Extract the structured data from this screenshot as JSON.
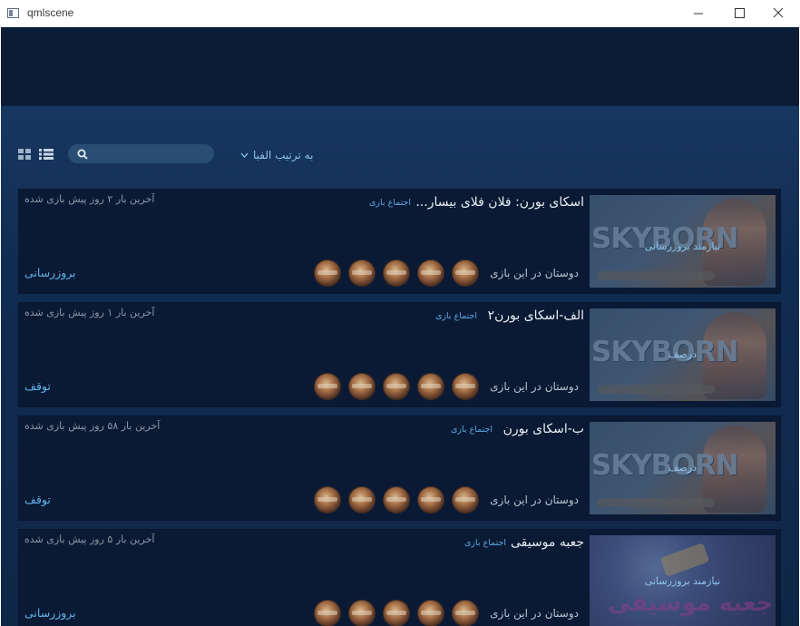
{
  "window": {
    "title": "qmlscene"
  },
  "toolbar": {
    "search_placeholder": "",
    "sort_label": "به ترتیب الفبا"
  },
  "games": [
    {
      "title": "اسکای بورن: فلان فلای بیسار...",
      "group_label": "اجتماع بازی",
      "last_played": "آخرین بار ۲ روز پیش بازی شده",
      "thumb_status": "نیازمند بروزرسانی",
      "friends_label": "دوستان در این بازی",
      "action": "بروزرسانی",
      "art": "skyborn"
    },
    {
      "title": "الف-اسکای بورن۲",
      "group_label": "اجتماع بازی",
      "last_played": "آخرین بار ۱ روز پیش بازی شده",
      "thumb_status": "درصف",
      "friends_label": "دوستان در این بازی",
      "action": "توقف",
      "art": "skyborn"
    },
    {
      "title": "ب-اسکای بورن",
      "group_label": "اجتماع بازی",
      "last_played": "آخرین بار ۵۸ روز پیش بازی شده",
      "thumb_status": "درصف",
      "friends_label": "دوستان در این بازی",
      "action": "توقف",
      "art": "skyborn"
    },
    {
      "title": "جعبه موسیقی",
      "group_label": "اجتماع بازی",
      "last_played": "آخرین بار ۵ روز پیش بازی شده",
      "thumb_status": "نیازمند بروزرسانی",
      "friends_label": "دوستان در این بازی",
      "action": "بروزرسانی",
      "art": "music",
      "art_text": "جعبه موسیقی"
    }
  ],
  "colors": {
    "accent": "#5fb2ea",
    "card_bg": "#0b1a34",
    "header_bg": "#0b1c37"
  }
}
